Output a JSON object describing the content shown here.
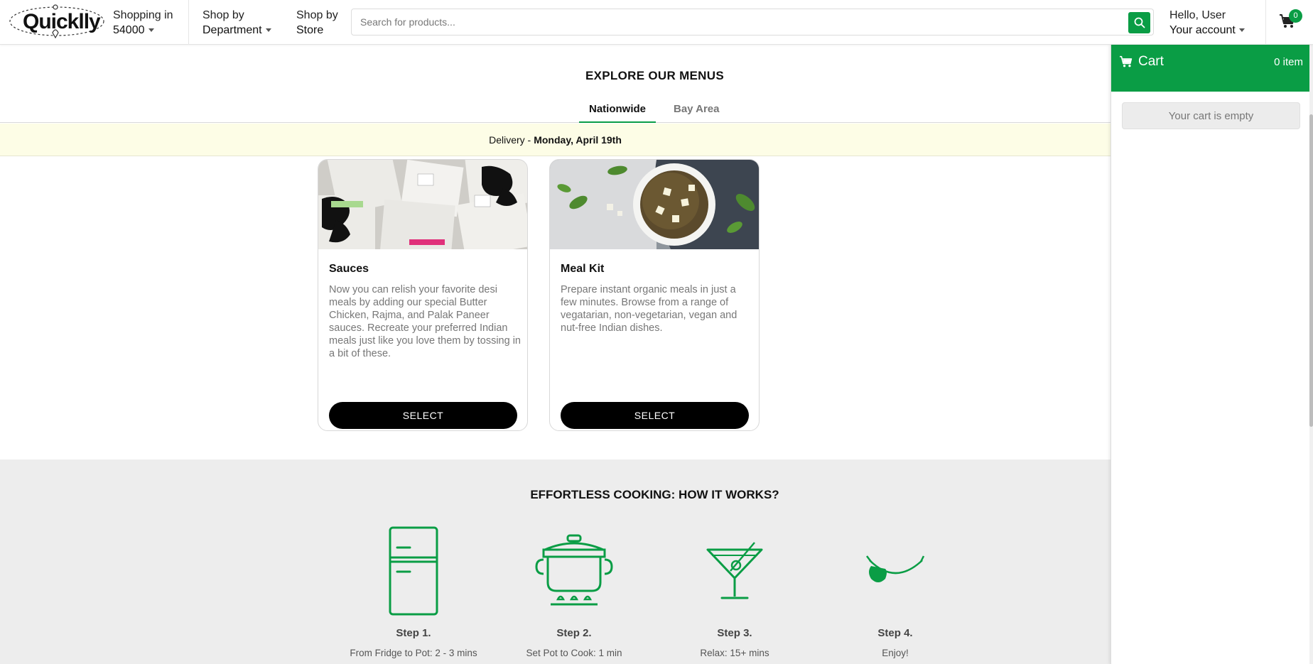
{
  "header": {
    "logo_text": "Quicklly",
    "location": {
      "label": "Shopping in",
      "value": "54000"
    },
    "department": {
      "label": "Shop by",
      "value": "Department"
    },
    "store": {
      "label": "Shop by",
      "value": "Store"
    },
    "search": {
      "placeholder": "Search for products..."
    },
    "account": {
      "greeting": "Hello, User",
      "label": "Your account"
    },
    "cart_badge": "0"
  },
  "menus": {
    "title": "EXPLORE OUR MENUS",
    "tabs": [
      {
        "label": "Nationwide",
        "active": true
      },
      {
        "label": "Bay Area",
        "active": false
      }
    ],
    "delivery": {
      "prefix": "Delivery -",
      "date": "Monday, April 19th"
    },
    "cards": [
      {
        "title": "Sauces",
        "description": "Now you can relish your favorite desi meals by adding our special Butter Chicken, Rajma, and Palak Paneer sauces. Recreate your preferred Indian meals just like you love them by tossing in a bit of these.",
        "button": "SELECT"
      },
      {
        "title": "Meal Kit",
        "description": "Prepare instant organic meals in just a few minutes. Browse from a range of vegatarian, non-vegetarian, vegan and nut-free Indian dishes.",
        "button": "SELECT"
      }
    ]
  },
  "how_it_works": {
    "title": "EFFORTLESS COOKING: HOW IT WORKS?",
    "steps": [
      {
        "label": "Step 1.",
        "text": "From Fridge to Pot: 2 - 3 mins",
        "icon": "fridge-icon"
      },
      {
        "label": "Step 2.",
        "text": "Set Pot to Cook: 1 min",
        "icon": "cooking-pot-icon"
      },
      {
        "label": "Step 3.",
        "text": "Relax: 15+ mins",
        "icon": "cocktail-icon"
      },
      {
        "label": "Step 4.",
        "text": "Enjoy!",
        "icon": "smile-icon"
      }
    ]
  },
  "cart": {
    "title": "Cart",
    "count_label": "0 item",
    "empty_message": "Your cart is empty"
  },
  "colors": {
    "brand_green": "#0a9d45",
    "delivery_bar_bg": "#fdfde6",
    "section_gray": "#ededed"
  }
}
